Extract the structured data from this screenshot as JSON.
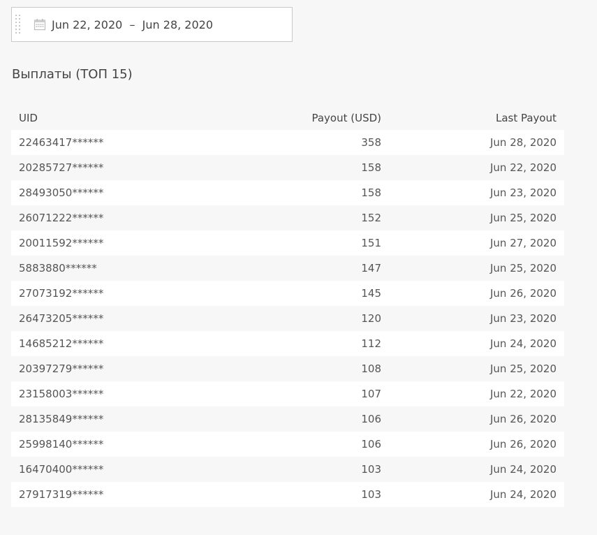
{
  "date_range": {
    "text": "Jun 22, 2020  –  Jun 28, 2020",
    "icon": "calendar-icon"
  },
  "section": {
    "title": "Выплаты (ТОП 15)"
  },
  "table": {
    "headers": {
      "uid": "UID",
      "payout": "Payout (USD)",
      "last_payout": "Last Payout"
    },
    "rows": [
      {
        "uid": "22463417******",
        "payout": "358",
        "last_payout": "Jun 28, 2020"
      },
      {
        "uid": "20285727******",
        "payout": "158",
        "last_payout": "Jun 22, 2020"
      },
      {
        "uid": "28493050******",
        "payout": "158",
        "last_payout": "Jun 23, 2020"
      },
      {
        "uid": "26071222******",
        "payout": "152",
        "last_payout": "Jun 25, 2020"
      },
      {
        "uid": "20011592******",
        "payout": "151",
        "last_payout": "Jun 27, 2020"
      },
      {
        "uid": "5883880******",
        "payout": "147",
        "last_payout": "Jun 25, 2020"
      },
      {
        "uid": "27073192******",
        "payout": "145",
        "last_payout": "Jun 26, 2020"
      },
      {
        "uid": "26473205******",
        "payout": "120",
        "last_payout": "Jun 23, 2020"
      },
      {
        "uid": "14685212******",
        "payout": "112",
        "last_payout": "Jun 24, 2020"
      },
      {
        "uid": "20397279******",
        "payout": "108",
        "last_payout": "Jun 25, 2020"
      },
      {
        "uid": "23158003******",
        "payout": "107",
        "last_payout": "Jun 22, 2020"
      },
      {
        "uid": "28135849******",
        "payout": "106",
        "last_payout": "Jun 26, 2020"
      },
      {
        "uid": "25998140******",
        "payout": "106",
        "last_payout": "Jun 26, 2020"
      },
      {
        "uid": "16470400******",
        "payout": "103",
        "last_payout": "Jun 24, 2020"
      },
      {
        "uid": "27917319******",
        "payout": "103",
        "last_payout": "Jun 24, 2020"
      }
    ]
  }
}
